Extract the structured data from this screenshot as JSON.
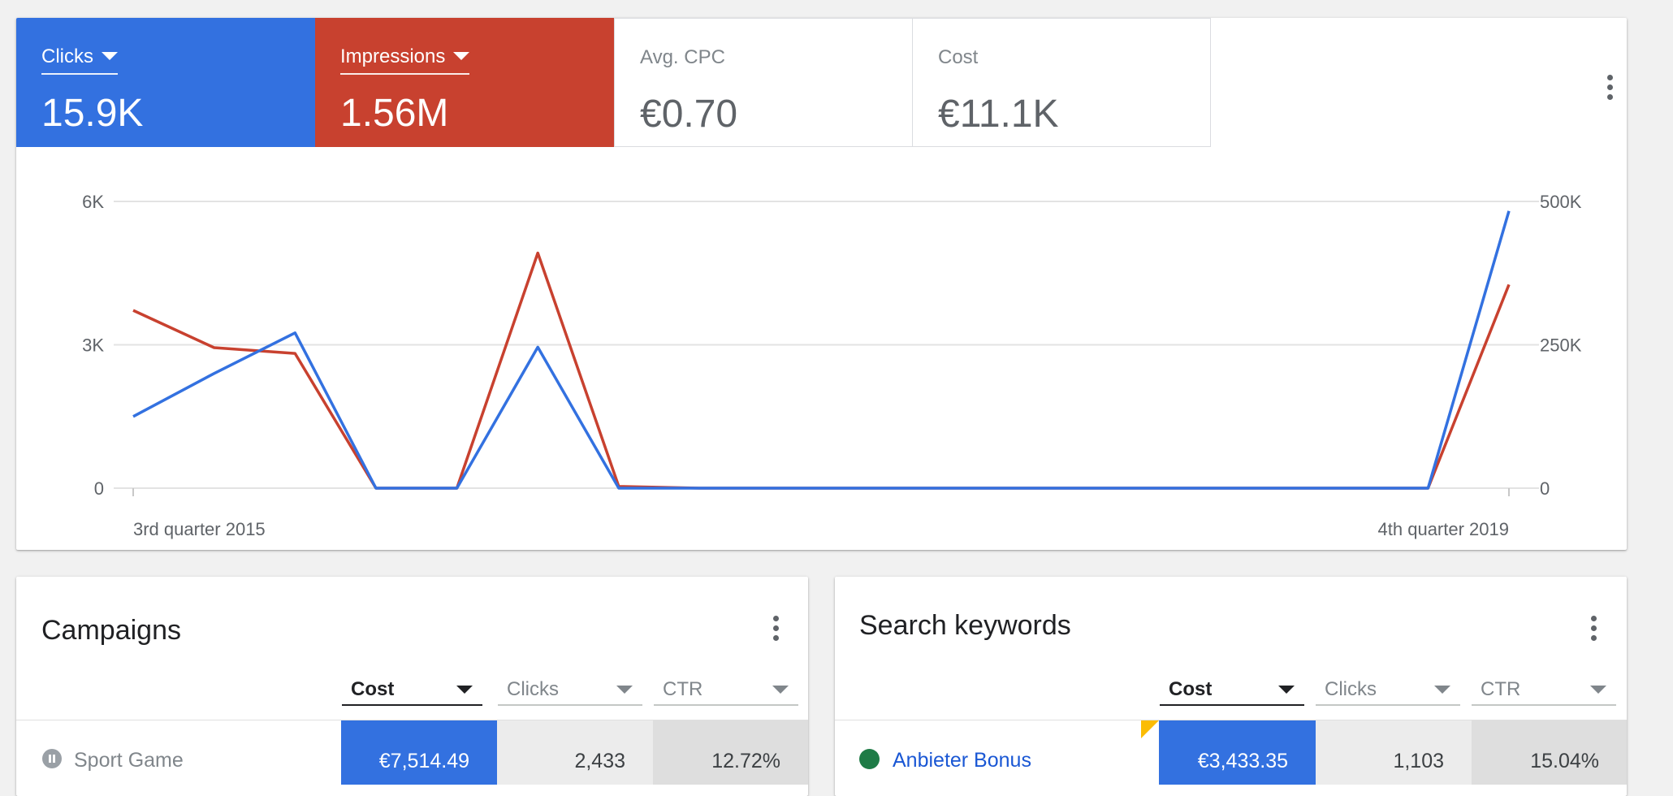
{
  "metrics": {
    "clicks": {
      "label": "Clicks",
      "value": "15.9K",
      "color": "#3371e0"
    },
    "impressions": {
      "label": "Impressions",
      "value": "1.56M",
      "color": "#c8412f"
    },
    "avg_cpc": {
      "label": "Avg. CPC",
      "value": "€0.70"
    },
    "cost": {
      "label": "Cost",
      "value": "€11.1K"
    }
  },
  "chart_data": {
    "type": "line",
    "x_labels": [
      "3rd quarter 2015",
      "4th quarter 2019"
    ],
    "x": [
      "3rd quarter 2015",
      "4th quarter 2015",
      "1st quarter 2016",
      "2nd quarter 2016",
      "3rd quarter 2016",
      "4th quarter 2016",
      "1st quarter 2017",
      "2nd quarter 2017",
      "3rd quarter 2017",
      "4th quarter 2017",
      "1st quarter 2018",
      "2nd quarter 2018",
      "3rd quarter 2018",
      "4th quarter 2018",
      "1st quarter 2019",
      "2nd quarter 2019",
      "3rd quarter 2019",
      "4th quarter 2019"
    ],
    "series": [
      {
        "name": "Clicks",
        "axis": "left",
        "color": "#3371e0",
        "values": [
          1500,
          2400,
          3250,
          0,
          0,
          2950,
          0,
          0,
          0,
          0,
          0,
          0,
          0,
          0,
          0,
          0,
          0,
          5800
        ]
      },
      {
        "name": "Impressions",
        "axis": "right",
        "color": "#c8412f",
        "values": [
          310000,
          245000,
          235000,
          0,
          0,
          410000,
          3000,
          0,
          0,
          0,
          0,
          0,
          0,
          0,
          0,
          0,
          0,
          355000
        ]
      }
    ],
    "y_left": {
      "ticks": [
        "0",
        "3K",
        "6K"
      ],
      "range": [
        0,
        6000
      ]
    },
    "y_right": {
      "ticks": [
        "0",
        "250K",
        "500K"
      ],
      "range": [
        0,
        500000
      ]
    },
    "grid": true
  },
  "campaigns": {
    "title": "Campaigns",
    "columns": [
      "Cost",
      "Clicks",
      "CTR"
    ],
    "rows": [
      {
        "name": "Sport Game",
        "status": "paused",
        "cost": "€7,514.49",
        "clicks": "2,433",
        "ctr": "12.72%"
      }
    ]
  },
  "keywords": {
    "title": "Search keywords",
    "columns": [
      "Cost",
      "Clicks",
      "CTR"
    ],
    "rows": [
      {
        "name": "Anbieter Bonus",
        "status": "enabled",
        "cost": "€3,433.35",
        "clicks": "1,103",
        "ctr": "15.04%"
      }
    ]
  }
}
